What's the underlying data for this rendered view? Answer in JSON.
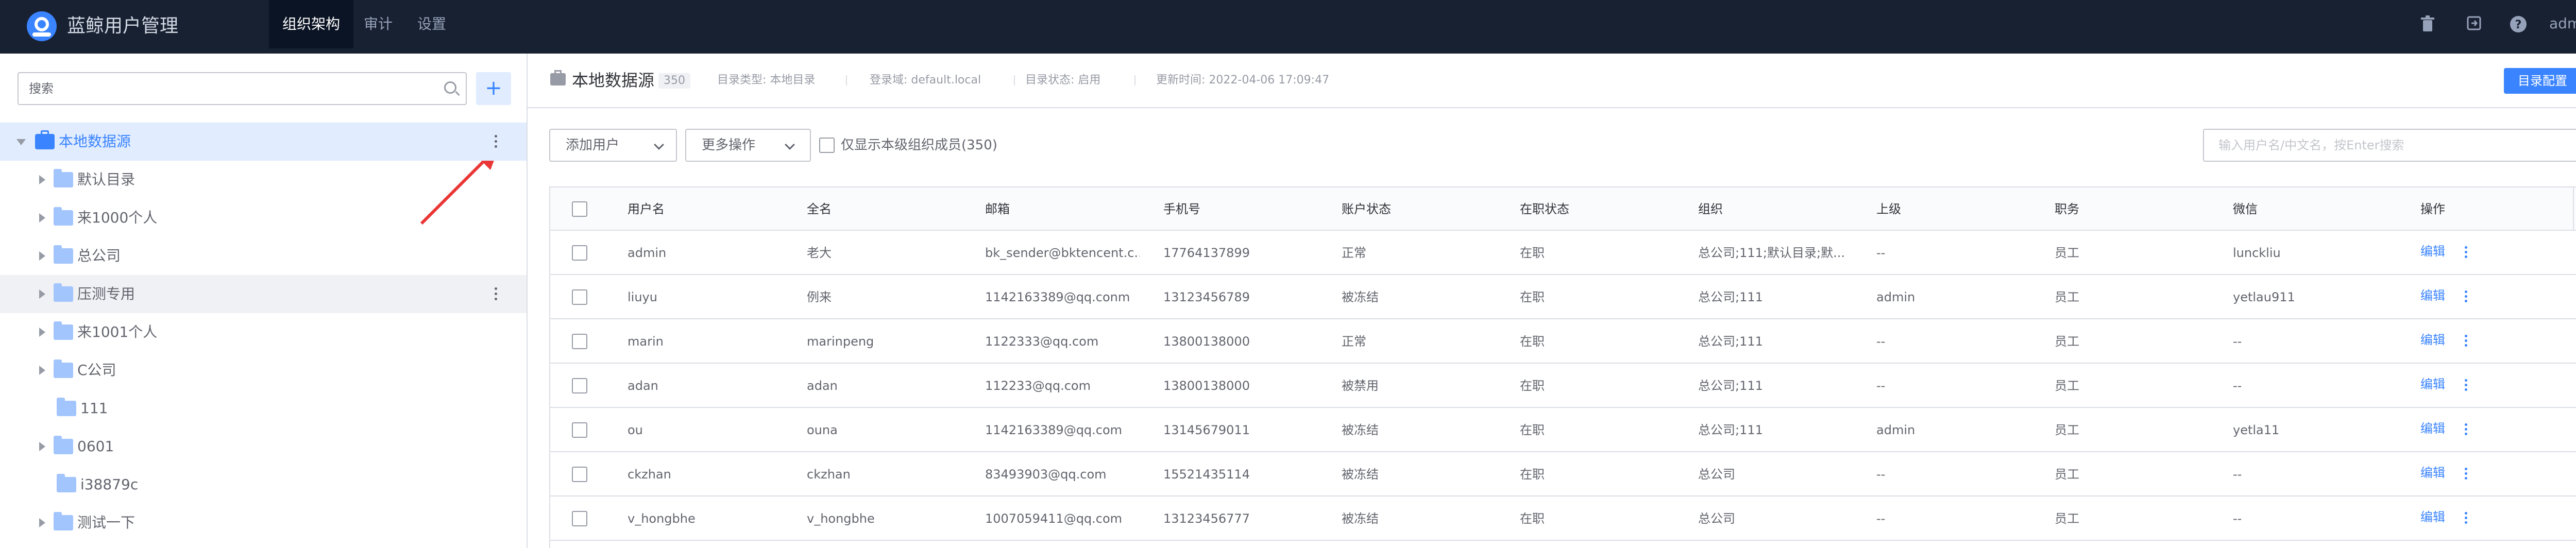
{
  "app": {
    "title": "蓝鲸用户管理",
    "user": "admin"
  },
  "nav": [
    {
      "label": "组织架构",
      "active": true
    },
    {
      "label": "审计",
      "active": false
    },
    {
      "label": "设置",
      "active": false
    }
  ],
  "top_icons": [
    "trash-icon",
    "export-icon",
    "help-icon"
  ],
  "sidebar": {
    "search_placeholder": "搜索",
    "add_label": "+",
    "tree": [
      {
        "label": "本地数据源",
        "level": 0,
        "expanded": true,
        "selected": true,
        "has_more": true
      },
      {
        "label": "默认目录",
        "level": 1,
        "expandable": true
      },
      {
        "label": "来1000个人",
        "level": 1,
        "expandable": true
      },
      {
        "label": "总公司",
        "level": 1,
        "expandable": true
      },
      {
        "label": "压测专用",
        "level": 1,
        "expandable": true,
        "hover": true,
        "has_more": true
      },
      {
        "label": "来1001个人",
        "level": 1,
        "expandable": true
      },
      {
        "label": "C公司",
        "level": 1,
        "expandable": true
      },
      {
        "label": "111",
        "level": 1,
        "expandable": false
      },
      {
        "label": "0601",
        "level": 1,
        "expandable": true
      },
      {
        "label": "i38879c",
        "level": 1,
        "expandable": false
      },
      {
        "label": "测试一下",
        "level": 1,
        "expandable": true
      }
    ]
  },
  "header": {
    "title": "本地数据源",
    "count": "350",
    "dir_type_label": "目录类型:",
    "dir_type_value": "本地目录",
    "domain_label": "登录域:",
    "domain_value": "default.local",
    "status_label": "目录状态:",
    "status_value": "启用",
    "updated_label": "更新时间:",
    "updated_value": "2022-04-06 17:09:47",
    "config_button": "目录配置"
  },
  "toolbar": {
    "add_user": "添加用户",
    "more_ops": "更多操作",
    "only_direct": "仅显示本级组织成员(350)",
    "search_placeholder": "输入用户名/中文名，按Enter搜索"
  },
  "table": {
    "columns": [
      "用户名",
      "全名",
      "邮箱",
      "手机号",
      "账户状态",
      "在职状态",
      "组织",
      "上级",
      "职务",
      "微信",
      "操作"
    ],
    "edit_label": "编辑",
    "rows": [
      [
        "admin",
        "老大",
        "bk_sender@bktencent.c...",
        "17764137899",
        "正常",
        "在职",
        "总公司;111;默认目录;默...",
        "--",
        "员工",
        "lunckliu"
      ],
      [
        "liuyu",
        "例来",
        "1142163389@qq.conm",
        "13123456789",
        "被冻结",
        "在职",
        "总公司;111",
        "admin",
        "员工",
        "yetlau911"
      ],
      [
        "marin",
        "marinpeng",
        "1122333@qq.com",
        "13800138000",
        "正常",
        "在职",
        "总公司;111",
        "--",
        "员工",
        "--"
      ],
      [
        "adan",
        "adan",
        "112233@qq.com",
        "13800138000",
        "被禁用",
        "在职",
        "总公司;111",
        "--",
        "员工",
        "--"
      ],
      [
        "ou",
        "ouna",
        "1142163389@qq.com",
        "13145679011",
        "被冻结",
        "在职",
        "总公司;111",
        "admin",
        "员工",
        "yetla11"
      ],
      [
        "ckzhan",
        "ckzhan",
        "83493903@qq.com",
        "15521435114",
        "被冻结",
        "在职",
        "总公司",
        "--",
        "员工",
        "--"
      ],
      [
        "v_hongbhe",
        "v_hongbhe",
        "1007059411@qq.com",
        "13123456777",
        "被冻结",
        "在职",
        "总公司",
        "--",
        "员工",
        "--"
      ]
    ]
  },
  "colors": {
    "accent": "#3a84ff",
    "topbar": "#182132",
    "selected_bg": "#e1ecff",
    "annotation_arrow": "#ea3636"
  }
}
